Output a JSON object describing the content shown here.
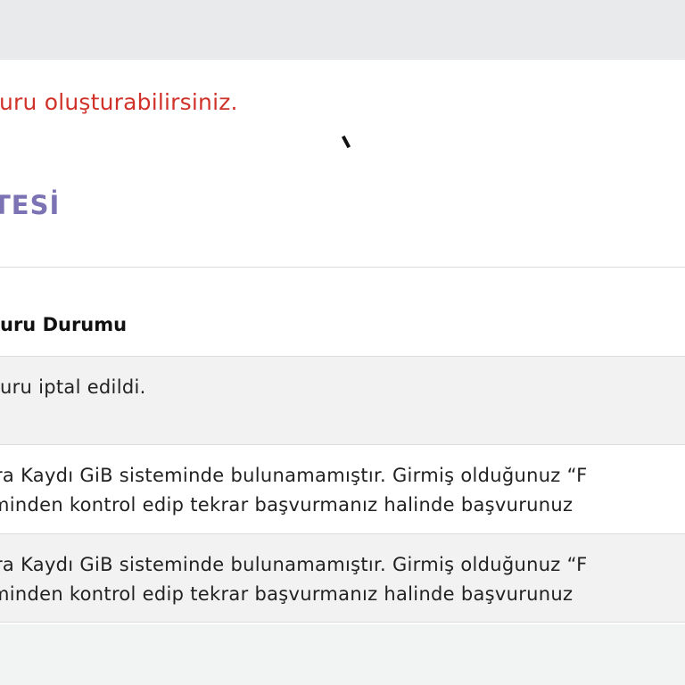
{
  "notice": {
    "text": "vuru oluşturabilirsiniz."
  },
  "section": {
    "title": "TESİ"
  },
  "table": {
    "header": "uru Durumu",
    "rows": [
      {
        "text": "uru iptal edildi."
      },
      {
        "line1": "ra Kaydı GiB sisteminde bulunamamıştır. Girmiş olduğunuz “F",
        "line2": "minden kontrol edip tekrar başvurmanız halinde başvurunuz"
      },
      {
        "line1": "ra Kaydı GiB sisteminde bulunamamıştır. Girmiş olduğunuz “F",
        "line2": "minden kontrol edip tekrar başvurmanız halinde başvurunuz"
      }
    ]
  },
  "colors": {
    "notice": "#d0322a",
    "section_title": "#7b73b3",
    "row_alt": "#f2f2f2",
    "page_bg": "#f2f3f3"
  }
}
